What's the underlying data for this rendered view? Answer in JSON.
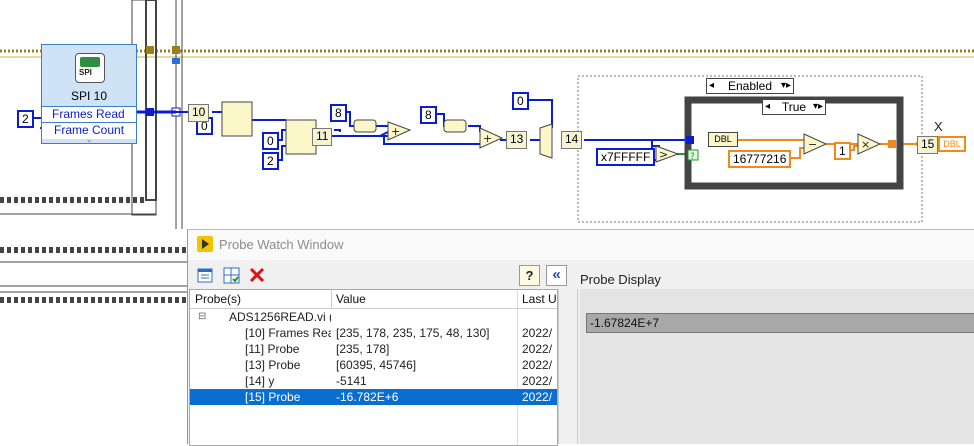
{
  "diagram": {
    "spi_node": {
      "title": "SPI 10",
      "icon_label": "SPI",
      "terminals": [
        "Frames Read",
        "Frame Count"
      ]
    },
    "constants": {
      "frame_count_in": "2",
      "c0a": "0",
      "c0b": "0",
      "c2": "2",
      "c8a": "8",
      "c8b": "8",
      "c0c": "0",
      "hex_mask": "x7FFFFF",
      "offset": "16777216",
      "one": "1"
    },
    "probes": [
      "10",
      "11",
      "13",
      "14",
      "15"
    ],
    "case_structure": {
      "outer_selector": "Enabled",
      "inner_selector": "True"
    },
    "dbl_label": "DBL",
    "x_label": "X",
    "dbl_out_label": "DBL"
  },
  "probe_window": {
    "title": "Probe Watch Window",
    "columns": [
      "Probe(s)",
      "Value",
      "Last U"
    ],
    "vi_name": "ADS1256READ.vi (",
    "rows": [
      {
        "probe": "[10] Frames Rea",
        "value": "[235, 178, 235, 175, 48, 130]",
        "last": "2022/"
      },
      {
        "probe": "[11] Probe",
        "value": "[235, 178]",
        "last": "2022/"
      },
      {
        "probe": "[13] Probe",
        "value": "[60395, 45746]",
        "last": "2022/"
      },
      {
        "probe": "[14] y",
        "value": "-5141",
        "last": "2022/"
      },
      {
        "probe": "[15] Probe",
        "value": "-16.782E+6",
        "last": "2022/"
      }
    ],
    "selected_row": 4,
    "display_label": "Probe Display",
    "display_value": "-1.67824E+7",
    "help_glyph": "?",
    "collapse_glyph": "«"
  }
}
